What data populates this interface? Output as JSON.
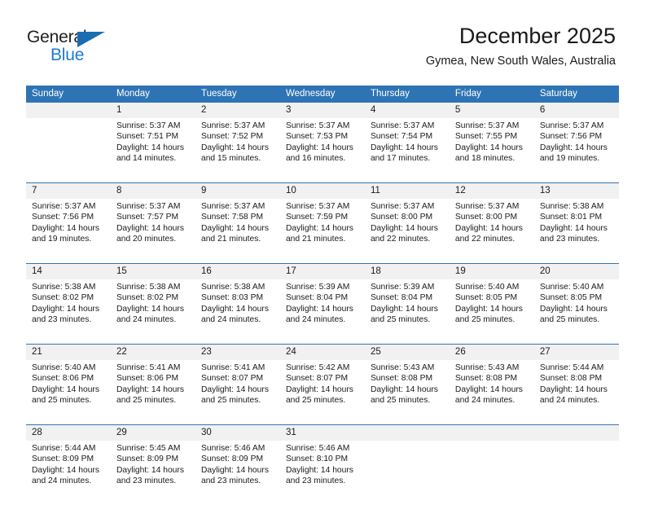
{
  "branding": {
    "logo_primary": "General",
    "logo_secondary": "Blue",
    "accent_blue": "#2e74b5",
    "logo_blue": "#1b7ad4"
  },
  "header": {
    "month_title": "December 2025",
    "location": "Gymea, New South Wales, Australia"
  },
  "weekday_headers": [
    "Sunday",
    "Monday",
    "Tuesday",
    "Wednesday",
    "Thursday",
    "Friday",
    "Saturday"
  ],
  "weeks": [
    [
      {
        "day": "",
        "sunrise": "",
        "sunset": "",
        "daylight_1": "",
        "daylight_2": ""
      },
      {
        "day": "1",
        "sunrise": "Sunrise: 5:37 AM",
        "sunset": "Sunset: 7:51 PM",
        "daylight_1": "Daylight: 14 hours",
        "daylight_2": "and 14 minutes."
      },
      {
        "day": "2",
        "sunrise": "Sunrise: 5:37 AM",
        "sunset": "Sunset: 7:52 PM",
        "daylight_1": "Daylight: 14 hours",
        "daylight_2": "and 15 minutes."
      },
      {
        "day": "3",
        "sunrise": "Sunrise: 5:37 AM",
        "sunset": "Sunset: 7:53 PM",
        "daylight_1": "Daylight: 14 hours",
        "daylight_2": "and 16 minutes."
      },
      {
        "day": "4",
        "sunrise": "Sunrise: 5:37 AM",
        "sunset": "Sunset: 7:54 PM",
        "daylight_1": "Daylight: 14 hours",
        "daylight_2": "and 17 minutes."
      },
      {
        "day": "5",
        "sunrise": "Sunrise: 5:37 AM",
        "sunset": "Sunset: 7:55 PM",
        "daylight_1": "Daylight: 14 hours",
        "daylight_2": "and 18 minutes."
      },
      {
        "day": "6",
        "sunrise": "Sunrise: 5:37 AM",
        "sunset": "Sunset: 7:56 PM",
        "daylight_1": "Daylight: 14 hours",
        "daylight_2": "and 19 minutes."
      }
    ],
    [
      {
        "day": "7",
        "sunrise": "Sunrise: 5:37 AM",
        "sunset": "Sunset: 7:56 PM",
        "daylight_1": "Daylight: 14 hours",
        "daylight_2": "and 19 minutes."
      },
      {
        "day": "8",
        "sunrise": "Sunrise: 5:37 AM",
        "sunset": "Sunset: 7:57 PM",
        "daylight_1": "Daylight: 14 hours",
        "daylight_2": "and 20 minutes."
      },
      {
        "day": "9",
        "sunrise": "Sunrise: 5:37 AM",
        "sunset": "Sunset: 7:58 PM",
        "daylight_1": "Daylight: 14 hours",
        "daylight_2": "and 21 minutes."
      },
      {
        "day": "10",
        "sunrise": "Sunrise: 5:37 AM",
        "sunset": "Sunset: 7:59 PM",
        "daylight_1": "Daylight: 14 hours",
        "daylight_2": "and 21 minutes."
      },
      {
        "day": "11",
        "sunrise": "Sunrise: 5:37 AM",
        "sunset": "Sunset: 8:00 PM",
        "daylight_1": "Daylight: 14 hours",
        "daylight_2": "and 22 minutes."
      },
      {
        "day": "12",
        "sunrise": "Sunrise: 5:37 AM",
        "sunset": "Sunset: 8:00 PM",
        "daylight_1": "Daylight: 14 hours",
        "daylight_2": "and 22 minutes."
      },
      {
        "day": "13",
        "sunrise": "Sunrise: 5:38 AM",
        "sunset": "Sunset: 8:01 PM",
        "daylight_1": "Daylight: 14 hours",
        "daylight_2": "and 23 minutes."
      }
    ],
    [
      {
        "day": "14",
        "sunrise": "Sunrise: 5:38 AM",
        "sunset": "Sunset: 8:02 PM",
        "daylight_1": "Daylight: 14 hours",
        "daylight_2": "and 23 minutes."
      },
      {
        "day": "15",
        "sunrise": "Sunrise: 5:38 AM",
        "sunset": "Sunset: 8:02 PM",
        "daylight_1": "Daylight: 14 hours",
        "daylight_2": "and 24 minutes."
      },
      {
        "day": "16",
        "sunrise": "Sunrise: 5:38 AM",
        "sunset": "Sunset: 8:03 PM",
        "daylight_1": "Daylight: 14 hours",
        "daylight_2": "and 24 minutes."
      },
      {
        "day": "17",
        "sunrise": "Sunrise: 5:39 AM",
        "sunset": "Sunset: 8:04 PM",
        "daylight_1": "Daylight: 14 hours",
        "daylight_2": "and 24 minutes."
      },
      {
        "day": "18",
        "sunrise": "Sunrise: 5:39 AM",
        "sunset": "Sunset: 8:04 PM",
        "daylight_1": "Daylight: 14 hours",
        "daylight_2": "and 25 minutes."
      },
      {
        "day": "19",
        "sunrise": "Sunrise: 5:40 AM",
        "sunset": "Sunset: 8:05 PM",
        "daylight_1": "Daylight: 14 hours",
        "daylight_2": "and 25 minutes."
      },
      {
        "day": "20",
        "sunrise": "Sunrise: 5:40 AM",
        "sunset": "Sunset: 8:05 PM",
        "daylight_1": "Daylight: 14 hours",
        "daylight_2": "and 25 minutes."
      }
    ],
    [
      {
        "day": "21",
        "sunrise": "Sunrise: 5:40 AM",
        "sunset": "Sunset: 8:06 PM",
        "daylight_1": "Daylight: 14 hours",
        "daylight_2": "and 25 minutes."
      },
      {
        "day": "22",
        "sunrise": "Sunrise: 5:41 AM",
        "sunset": "Sunset: 8:06 PM",
        "daylight_1": "Daylight: 14 hours",
        "daylight_2": "and 25 minutes."
      },
      {
        "day": "23",
        "sunrise": "Sunrise: 5:41 AM",
        "sunset": "Sunset: 8:07 PM",
        "daylight_1": "Daylight: 14 hours",
        "daylight_2": "and 25 minutes."
      },
      {
        "day": "24",
        "sunrise": "Sunrise: 5:42 AM",
        "sunset": "Sunset: 8:07 PM",
        "daylight_1": "Daylight: 14 hours",
        "daylight_2": "and 25 minutes."
      },
      {
        "day": "25",
        "sunrise": "Sunrise: 5:43 AM",
        "sunset": "Sunset: 8:08 PM",
        "daylight_1": "Daylight: 14 hours",
        "daylight_2": "and 25 minutes."
      },
      {
        "day": "26",
        "sunrise": "Sunrise: 5:43 AM",
        "sunset": "Sunset: 8:08 PM",
        "daylight_1": "Daylight: 14 hours",
        "daylight_2": "and 24 minutes."
      },
      {
        "day": "27",
        "sunrise": "Sunrise: 5:44 AM",
        "sunset": "Sunset: 8:08 PM",
        "daylight_1": "Daylight: 14 hours",
        "daylight_2": "and 24 minutes."
      }
    ],
    [
      {
        "day": "28",
        "sunrise": "Sunrise: 5:44 AM",
        "sunset": "Sunset: 8:09 PM",
        "daylight_1": "Daylight: 14 hours",
        "daylight_2": "and 24 minutes."
      },
      {
        "day": "29",
        "sunrise": "Sunrise: 5:45 AM",
        "sunset": "Sunset: 8:09 PM",
        "daylight_1": "Daylight: 14 hours",
        "daylight_2": "and 23 minutes."
      },
      {
        "day": "30",
        "sunrise": "Sunrise: 5:46 AM",
        "sunset": "Sunset: 8:09 PM",
        "daylight_1": "Daylight: 14 hours",
        "daylight_2": "and 23 minutes."
      },
      {
        "day": "31",
        "sunrise": "Sunrise: 5:46 AM",
        "sunset": "Sunset: 8:10 PM",
        "daylight_1": "Daylight: 14 hours",
        "daylight_2": "and 23 minutes."
      },
      {
        "day": "",
        "sunrise": "",
        "sunset": "",
        "daylight_1": "",
        "daylight_2": ""
      },
      {
        "day": "",
        "sunrise": "",
        "sunset": "",
        "daylight_1": "",
        "daylight_2": ""
      },
      {
        "day": "",
        "sunrise": "",
        "sunset": "",
        "daylight_1": "",
        "daylight_2": ""
      }
    ]
  ]
}
